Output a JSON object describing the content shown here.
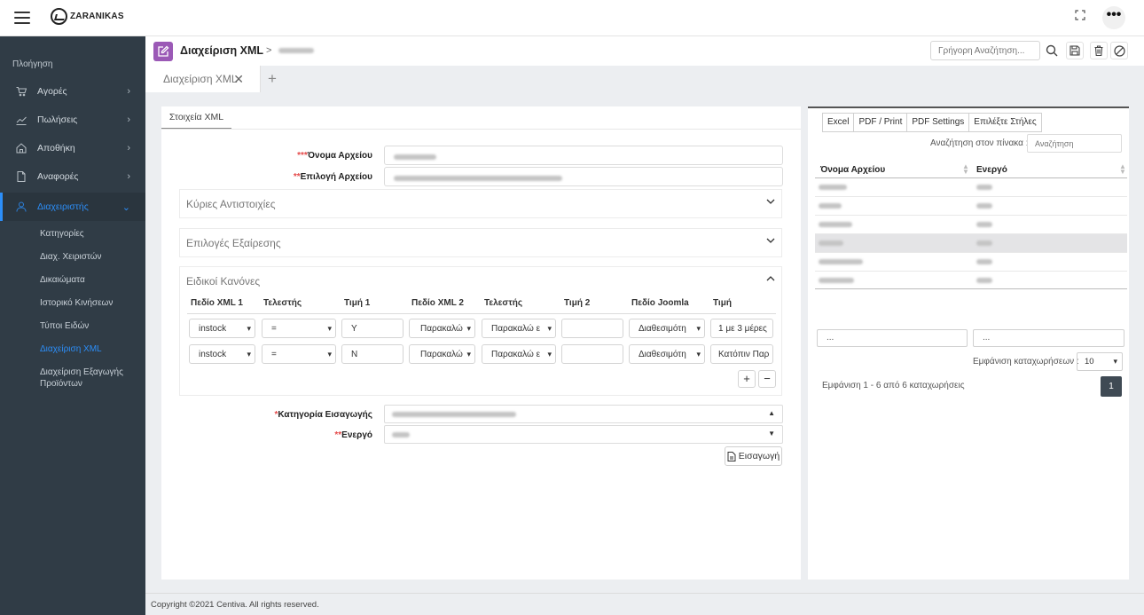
{
  "brand": {
    "name": "ZARANIKAS"
  },
  "header": {
    "more_label": "•••"
  },
  "sidebar": {
    "nav_title": "Πλοήγηση",
    "items": [
      {
        "label": "Αγορές",
        "icon": "cart-icon"
      },
      {
        "label": "Πωλήσεις",
        "icon": "chart-line-icon"
      },
      {
        "label": "Αποθήκη",
        "icon": "home-icon"
      },
      {
        "label": "Αναφορές",
        "icon": "document-icon"
      },
      {
        "label": "Διαχειριστής",
        "icon": "user-icon"
      }
    ],
    "subitems": [
      "Κατηγορίες",
      "Διαχ. Χειριστών",
      "Δικαιώματα",
      "Ιστορικό Κινήσεων",
      "Τύποι Ειδών",
      "Διαχείριση XML",
      "Διαχείριση Εξαγωγής Προϊόντων"
    ]
  },
  "page": {
    "title": "Διαχείριση XML",
    "sep": ">",
    "search_placeholder": "Γρήγορη Αναζήτηση..."
  },
  "tabs": {
    "active_label": "Διαχείριση XML",
    "close": "✕",
    "add": "+"
  },
  "form": {
    "tab_label": "Στοιχεία XML",
    "req3": "***",
    "req2": "**",
    "req1": "*",
    "filename_label": "Όνομα Αρχείου",
    "fileselect_label": "Επιλογή Αρχείου",
    "section_main": "Κύριες Αντιστοιχίες",
    "section_excl": "Επιλογές Εξαίρεσης",
    "section_rules": "Ειδικοί Κανόνες",
    "rules_headers": [
      "Πεδίο XML 1",
      "Τελεστής",
      "Τιμή 1",
      "Πεδίο XML 2",
      "Τελεστής",
      "Τιμή 2",
      "Πεδίο Joomla",
      "Τιμή"
    ],
    "rules_rows": [
      [
        "instock",
        "=",
        "Y",
        "Παρακαλώ",
        "Παρακαλώ ε",
        "",
        "Διαθεσιμότη",
        "1 με 3 μέρες"
      ],
      [
        "instock",
        "=",
        "N",
        "Παρακαλώ",
        "Παρακαλώ ε",
        "",
        "Διαθεσιμότη",
        "Κατόπιν Παρ"
      ]
    ],
    "plus": "+",
    "minus": "−",
    "import_cat_label": "Κατηγορία Εισαγωγής",
    "active_label": "Ενεργό",
    "import_button": "Εισαγωγή"
  },
  "table": {
    "buttons": [
      "Excel",
      "PDF / Print",
      "PDF Settings",
      "Επιλέξτε Στήλες"
    ],
    "search_label": "Αναζήτηση στον πίνακα :",
    "search_placeholder": "Αναζήτηση",
    "col1": "Όνομα Αρχείου",
    "col2": "Ενεργό",
    "filter_placeholder": "...",
    "length_label": "Εμφάνιση καταχωρήσεων :",
    "length_value": "10",
    "info": "Εμφάνιση 1 - 6 από 6 καταχωρήσεις",
    "page": "1"
  },
  "footer": {
    "text": "Copyright ©2021 Centiva. All rights reserved."
  }
}
